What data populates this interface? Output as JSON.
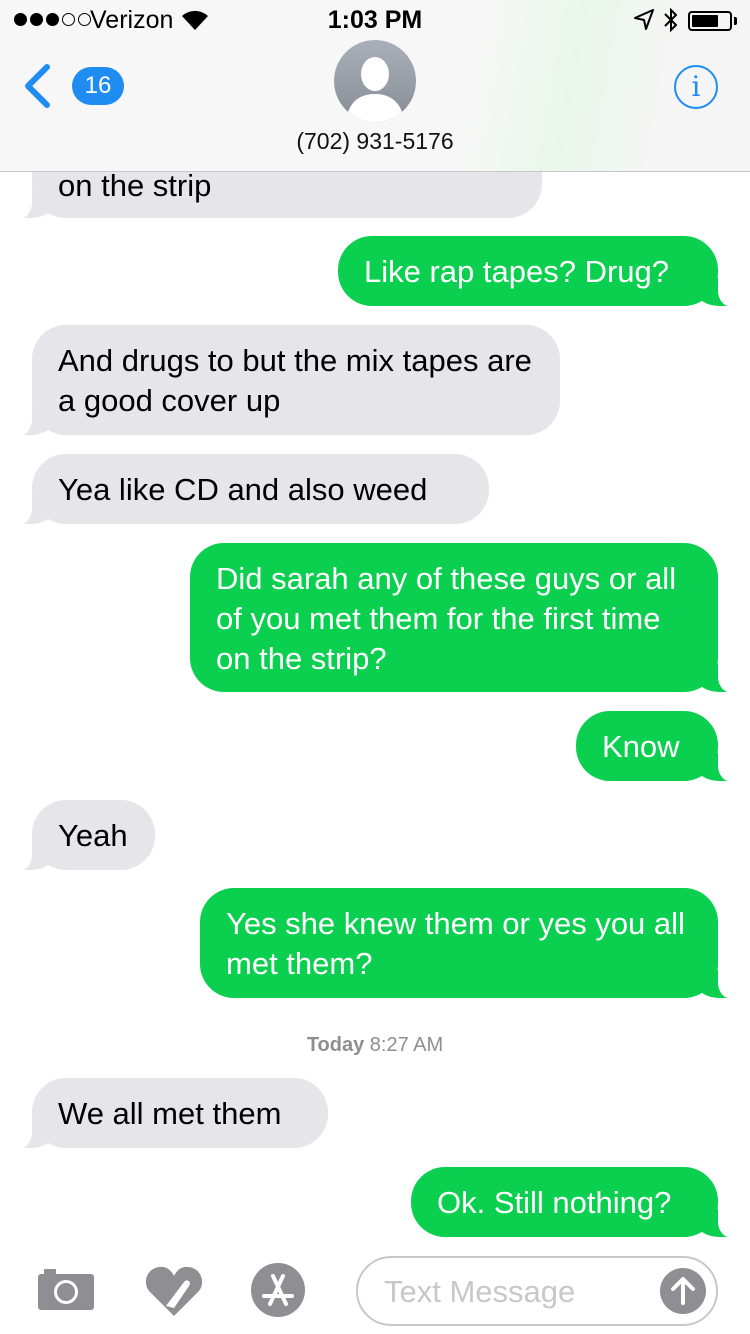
{
  "status_bar": {
    "carrier": "Verizon",
    "time": "1:03 PM"
  },
  "header": {
    "back_badge": "16",
    "contact": "(702) 931-5176",
    "info_label": "i"
  },
  "messages": [
    {
      "from": "them",
      "text": "on the strip"
    },
    {
      "from": "me",
      "text": "Like rap tapes? Drug?"
    },
    {
      "from": "them",
      "text": "And drugs to but the mix tapes are a good cover up"
    },
    {
      "from": "them",
      "text": "Yea like CD and also weed"
    },
    {
      "from": "me",
      "text": "Did sarah any of these guys or all of you met them for the first time on the strip?"
    },
    {
      "from": "me",
      "text": "Know"
    },
    {
      "from": "them",
      "text": "Yeah"
    },
    {
      "from": "me",
      "text": "Yes she knew them or yes you all met them?"
    },
    {
      "from": "them",
      "text": "We all met them"
    },
    {
      "from": "me",
      "text": "Ok. Still nothing?"
    }
  ],
  "timestamp": {
    "day": "Today",
    "time": "8:27 AM"
  },
  "input": {
    "placeholder": "Text Message",
    "icons": [
      "camera-icon",
      "digital-touch-icon",
      "app-store-icon",
      "send-icon"
    ]
  },
  "colors": {
    "outgoing_bubble": "#0bd04f",
    "incoming_bubble": "#e5e5ea",
    "accent": "#1e8cf0"
  }
}
